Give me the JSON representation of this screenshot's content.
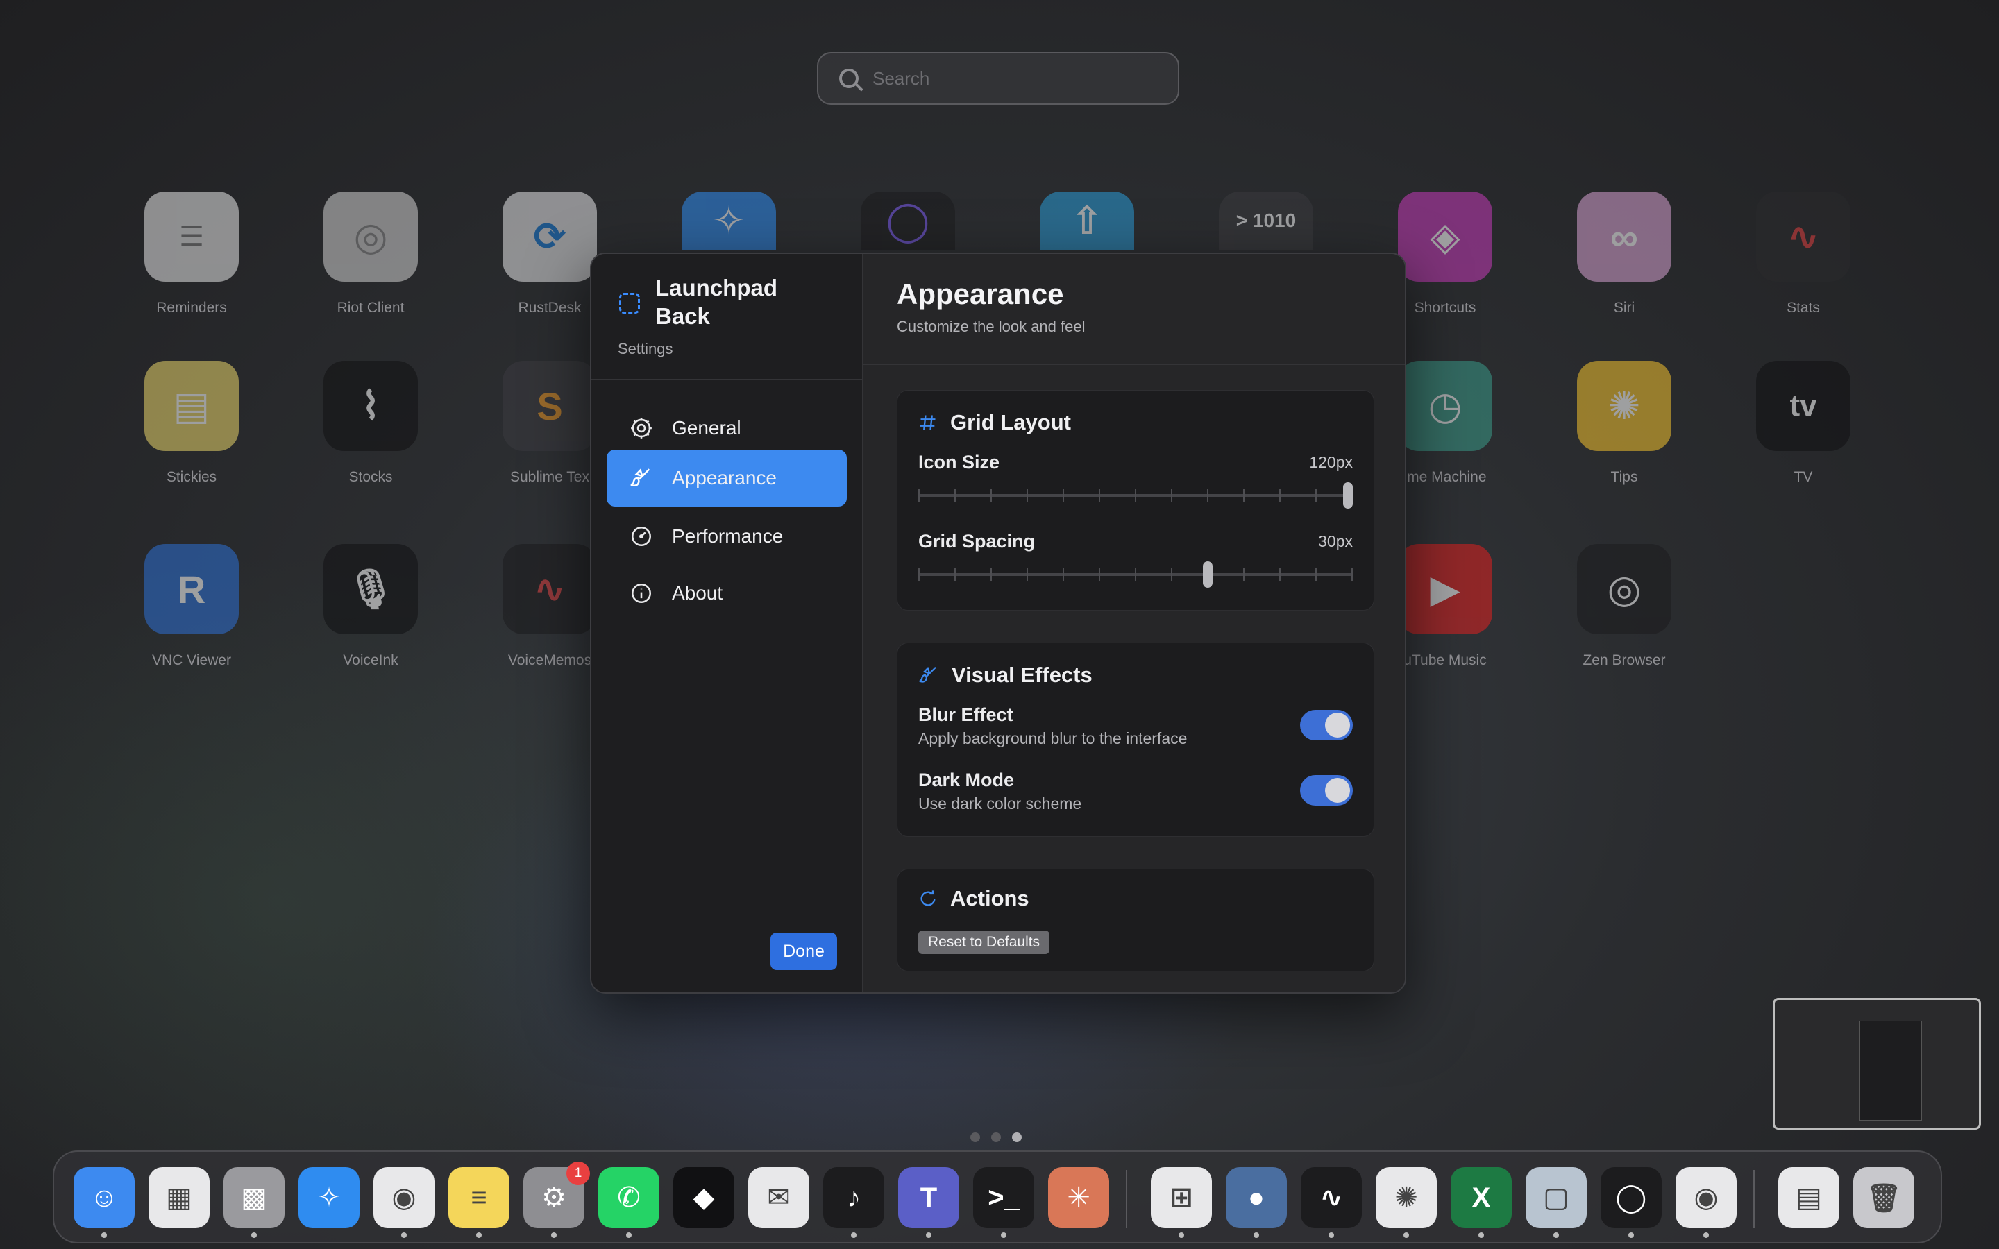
{
  "search": {
    "placeholder": "Search"
  },
  "apps": [
    {
      "label": "Reminders",
      "icon": "reminders-icon",
      "color": "#e6e6e6"
    },
    {
      "label": "Riot Client",
      "icon": "riot-client-icon",
      "color": "#cfcfcf"
    },
    {
      "label": "RustDesk",
      "icon": "rustdesk-icon",
      "color": "#1a7bd6"
    },
    {
      "label": "Shortcuts",
      "icon": "shortcuts-icon",
      "color": "#c43bb8"
    },
    {
      "label": "Siri",
      "icon": "siri-icon",
      "color": "#d6a0d0"
    },
    {
      "label": "Stats",
      "icon": "stats-icon",
      "color": "#2a2a2c"
    },
    {
      "label": "Stickies",
      "icon": "stickies-icon",
      "color": "#e8d36a"
    },
    {
      "label": "Stocks",
      "icon": "stocks-icon",
      "color": "#111113"
    },
    {
      "label": "Sublime Tex",
      "icon": "sublime-text-icon",
      "color": "#3b3b3f"
    },
    {
      "label": "ime Machine",
      "icon": "time-machine-icon",
      "color": "#3a9a88"
    },
    {
      "label": "Tips",
      "icon": "tips-icon",
      "color": "#f2c12e"
    },
    {
      "label": "TV",
      "icon": "tv-icon",
      "color": "#111113"
    },
    {
      "label": "VNC Viewer",
      "icon": "vnc-viewer-icon",
      "color": "#2d6fd3"
    },
    {
      "label": "VoiceInk",
      "icon": "voiceink-icon",
      "color": "#111113"
    },
    {
      "label": "VoiceMemos",
      "icon": "voicememos-icon",
      "color": "#1c1c1e"
    },
    {
      "label": "uTube Music",
      "icon": "youtube-music-icon",
      "color": "#e02020"
    },
    {
      "label": "Zen Browser",
      "icon": "zen-browser-icon",
      "color": "#1c1c1e"
    }
  ],
  "dialog": {
    "sidebar": {
      "title": "Launchpad Back",
      "subtitle": "Settings",
      "items": [
        {
          "label": "General",
          "icon": "gear-icon",
          "active": false
        },
        {
          "label": "Appearance",
          "icon": "paintbrush-icon",
          "active": true
        },
        {
          "label": "Performance",
          "icon": "speedometer-icon",
          "active": false
        },
        {
          "label": "About",
          "icon": "info-icon",
          "active": false
        }
      ],
      "done_label": "Done"
    },
    "main": {
      "title": "Appearance",
      "subtitle": "Customize the look and feel",
      "grid_layout": {
        "title": "Grid Layout",
        "icon_size": {
          "label": "Icon Size",
          "value": "120px",
          "level": 1.0
        },
        "grid_spacing": {
          "label": "Grid Spacing",
          "value": "30px",
          "level": 0.67
        }
      },
      "visual_effects": {
        "title": "Visual Effects",
        "blur": {
          "label": "Blur Effect",
          "desc": "Apply background blur to the interface",
          "on": true
        },
        "dark": {
          "label": "Dark Mode",
          "desc": "Use dark color scheme",
          "on": true
        }
      },
      "actions": {
        "title": "Actions",
        "reset_label": "Reset to Defaults"
      }
    }
  },
  "page_dots": {
    "count": 3,
    "current": 3
  },
  "dock": {
    "items": [
      {
        "name": "finder-icon",
        "color": "#3d8af0",
        "glyph": "☺",
        "running": true
      },
      {
        "name": "launchpad-icon",
        "color": "#e8e8ea",
        "glyph": "▦",
        "running": false
      },
      {
        "name": "launchpad-grid-icon",
        "color": "#9a9a9e",
        "glyph": "▩",
        "running": true
      },
      {
        "name": "safari-icon",
        "color": "#2f8cf0",
        "glyph": "✧",
        "running": false
      },
      {
        "name": "chrome-icon",
        "color": "#e8e8ea",
        "glyph": "◉",
        "running": true
      },
      {
        "name": "notes-icon",
        "color": "#f4d65a",
        "glyph": "≡",
        "running": true
      },
      {
        "name": "system-settings-icon",
        "color": "#8e8e92",
        "glyph": "⚙",
        "running": true,
        "badge": "1"
      },
      {
        "name": "whatsapp-icon",
        "color": "#25d366",
        "glyph": "✆",
        "running": true
      },
      {
        "name": "cube-app-icon",
        "color": "#111113",
        "glyph": "◆",
        "running": false
      },
      {
        "name": "mail-icon",
        "color": "#e8e8ea",
        "glyph": "✉",
        "running": false
      },
      {
        "name": "voiceink-dock-icon",
        "color": "#1c1c1e",
        "glyph": "♪",
        "running": true
      },
      {
        "name": "teams-icon",
        "color": "#5b5fc7",
        "glyph": "T",
        "running": true
      },
      {
        "name": "terminal-icon",
        "color": "#1c1c1e",
        "glyph": ">_",
        "running": true
      },
      {
        "name": "claude-icon",
        "color": "#d97757",
        "glyph": "✳",
        "running": false
      },
      {
        "name": "windows-app-icon",
        "color": "#e8e8ea",
        "glyph": "⊞",
        "running": true
      },
      {
        "name": "network-app-icon",
        "color": "#4a6ea0",
        "glyph": "●",
        "running": true
      },
      {
        "name": "activity-monitor-icon",
        "color": "#1c1c1e",
        "glyph": "∿",
        "running": true
      },
      {
        "name": "chatgpt-icon",
        "color": "#e8e8ea",
        "glyph": "✺",
        "running": true
      },
      {
        "name": "excel-icon",
        "color": "#1d7a43",
        "glyph": "X",
        "running": true
      },
      {
        "name": "preview-app-icon",
        "color": "#b8c4d0",
        "glyph": "▢",
        "running": true
      },
      {
        "name": "zen-dock-icon",
        "color": "#1c1c1e",
        "glyph": "◯",
        "running": true
      },
      {
        "name": "chrome-dock-icon",
        "color": "#e8e8ea",
        "glyph": "◉",
        "running": true
      },
      {
        "name": "downloads-icon",
        "color": "#e8e8ea",
        "glyph": "▤",
        "running": false
      },
      {
        "name": "trash-icon",
        "color": "#c8c8cc",
        "glyph": "🗑",
        "running": false
      }
    ]
  }
}
